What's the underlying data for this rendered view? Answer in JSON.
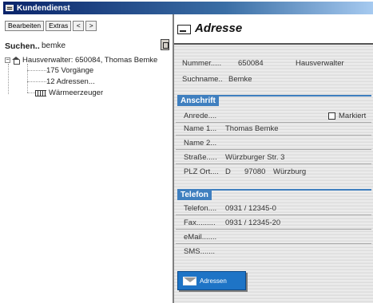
{
  "window": {
    "title": "Kundendienst"
  },
  "toolbar": {
    "edit_label": "Bearbeiten",
    "extras_label": "Extras",
    "prev_label": "<",
    "next_label": ">"
  },
  "search": {
    "label": "Suchen..",
    "value": "bemke"
  },
  "tree": {
    "root_expander": "−",
    "root_label": "Hausverwalter: 650084, Thomas Bemke",
    "children": [
      {
        "label": "175 Vorgänge"
      },
      {
        "label": "12 Adressen..."
      },
      {
        "label": "Wärmeerzeuger"
      }
    ]
  },
  "detail": {
    "title": "Adresse",
    "nummer_label": "Nummer.....",
    "nummer_value": "650084",
    "type_value": "Hausverwalter",
    "suchname_label": "Suchname..",
    "suchname_value": "Bemke",
    "anschrift": {
      "heading": "Anschrift",
      "anrede_label": "Anrede....",
      "markiert_label": "Markiert",
      "name1_label": "Name 1...",
      "name1_value": "Thomas Bemke",
      "name2_label": "Name 2...",
      "strasse_label": "Straße.....",
      "strasse_value": "Würzburger Str. 3",
      "plzort_label": "PLZ Ort....",
      "country_value": "D",
      "plz_value": "97080",
      "ort_value": "Würzburg"
    },
    "telefon": {
      "heading": "Telefon",
      "telefon_label": "Telefon....",
      "telefon_value": "0931 / 12345-0",
      "fax_label": "Fax.........",
      "fax_value": "0931 / 12345-20",
      "email_label": "eMail.......",
      "sms_label": "SMS......."
    },
    "adressen_button": "Adressen"
  },
  "colors": {
    "section_blue": "#3f7fbf",
    "button_blue": "#1e74c6",
    "title_blue": "#0a246a"
  }
}
